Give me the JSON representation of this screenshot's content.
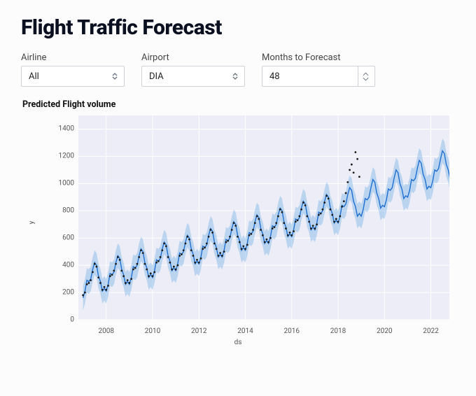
{
  "page": {
    "title": "Flight Traffic Forecast"
  },
  "controls": {
    "airline": {
      "label": "Airline",
      "value": "All"
    },
    "airport": {
      "label": "Airport",
      "value": "DIA"
    },
    "months": {
      "label": "Months to Forecast",
      "value": "48"
    }
  },
  "chart_meta": {
    "title": "Predicted Flight volume"
  },
  "chart_data": {
    "type": "line",
    "title": "Predicted Flight volume",
    "xlabel": "ds",
    "ylabel": "y",
    "xlim": [
      2006.8,
      2022.8
    ],
    "ylim": [
      0,
      1500
    ],
    "xticks": [
      2008,
      2010,
      2012,
      2014,
      2016,
      2018,
      2020,
      2022
    ],
    "yticks": [
      0,
      200,
      400,
      600,
      800,
      1000,
      1200,
      1400
    ],
    "series": [
      {
        "name": "yhat",
        "role": "forecast",
        "x_start": 2007.0,
        "x_step_months": 1,
        "values": [
          160,
          210,
          290,
          280,
          300,
          370,
          420,
          400,
          320,
          280,
          210,
          230,
          210,
          260,
          340,
          330,
          350,
          420,
          470,
          450,
          370,
          330,
          260,
          280,
          260,
          310,
          390,
          380,
          400,
          470,
          520,
          500,
          420,
          380,
          310,
          330,
          310,
          360,
          440,
          430,
          450,
          520,
          570,
          550,
          470,
          430,
          360,
          380,
          360,
          410,
          490,
          480,
          500,
          570,
          620,
          600,
          520,
          480,
          410,
          430,
          410,
          460,
          540,
          530,
          550,
          620,
          670,
          650,
          570,
          530,
          460,
          480,
          460,
          510,
          590,
          580,
          600,
          670,
          720,
          700,
          620,
          580,
          510,
          530,
          510,
          560,
          640,
          630,
          650,
          720,
          770,
          750,
          670,
          630,
          560,
          580,
          560,
          610,
          690,
          680,
          700,
          770,
          820,
          800,
          720,
          680,
          610,
          630,
          610,
          660,
          740,
          730,
          750,
          820,
          870,
          850,
          770,
          730,
          660,
          680,
          660,
          710,
          790,
          780,
          800,
          870,
          920,
          900,
          820,
          780,
          710,
          730,
          710,
          760,
          840,
          830,
          850,
          920,
          970,
          950,
          870,
          830,
          760,
          780,
          760,
          810,
          890,
          880,
          900,
          970,
          1030,
          1010,
          930,
          890,
          820,
          840,
          830,
          880,
          960,
          950,
          970,
          1040,
          1100,
          1080,
          1000,
          960,
          890,
          910,
          900,
          950,
          1030,
          1020,
          1040,
          1110,
          1170,
          1150,
          1070,
          1030,
          960,
          980,
          970,
          1020,
          1100,
          1090,
          1110,
          1180,
          1240,
          1220,
          1140,
          1100,
          1030,
          1050
        ]
      },
      {
        "name": "yhat_band_halfwidth",
        "role": "uncertainty-halfwidth",
        "value": 90
      },
      {
        "name": "observed",
        "role": "scatter",
        "x_start": 2007.0,
        "x_step_months": 1,
        "values": [
          180,
          200,
          260,
          270,
          290,
          350,
          410,
          390,
          310,
          270,
          220,
          240,
          220,
          250,
          320,
          330,
          360,
          410,
          460,
          440,
          360,
          320,
          270,
          290,
          270,
          300,
          370,
          380,
          410,
          460,
          510,
          490,
          410,
          370,
          320,
          340,
          320,
          350,
          420,
          430,
          460,
          510,
          560,
          540,
          460,
          420,
          370,
          390,
          370,
          400,
          470,
          480,
          510,
          560,
          610,
          590,
          510,
          470,
          420,
          440,
          420,
          450,
          520,
          530,
          560,
          610,
          660,
          640,
          560,
          520,
          470,
          490,
          470,
          500,
          570,
          580,
          610,
          660,
          710,
          690,
          610,
          570,
          520,
          540,
          520,
          550,
          620,
          630,
          660,
          710,
          760,
          740,
          660,
          620,
          570,
          590,
          570,
          600,
          670,
          680,
          710,
          760,
          810,
          790,
          710,
          670,
          620,
          640,
          620,
          650,
          720,
          730,
          760,
          810,
          860,
          840,
          760,
          720,
          670,
          690,
          670,
          700,
          770,
          780,
          810,
          860,
          910,
          890,
          810,
          770,
          720,
          740,
          720,
          760,
          830,
          870,
          930,
          1010,
          1100,
          1140,
          1080,
          1230,
          1180,
          1050
        ]
      }
    ]
  }
}
